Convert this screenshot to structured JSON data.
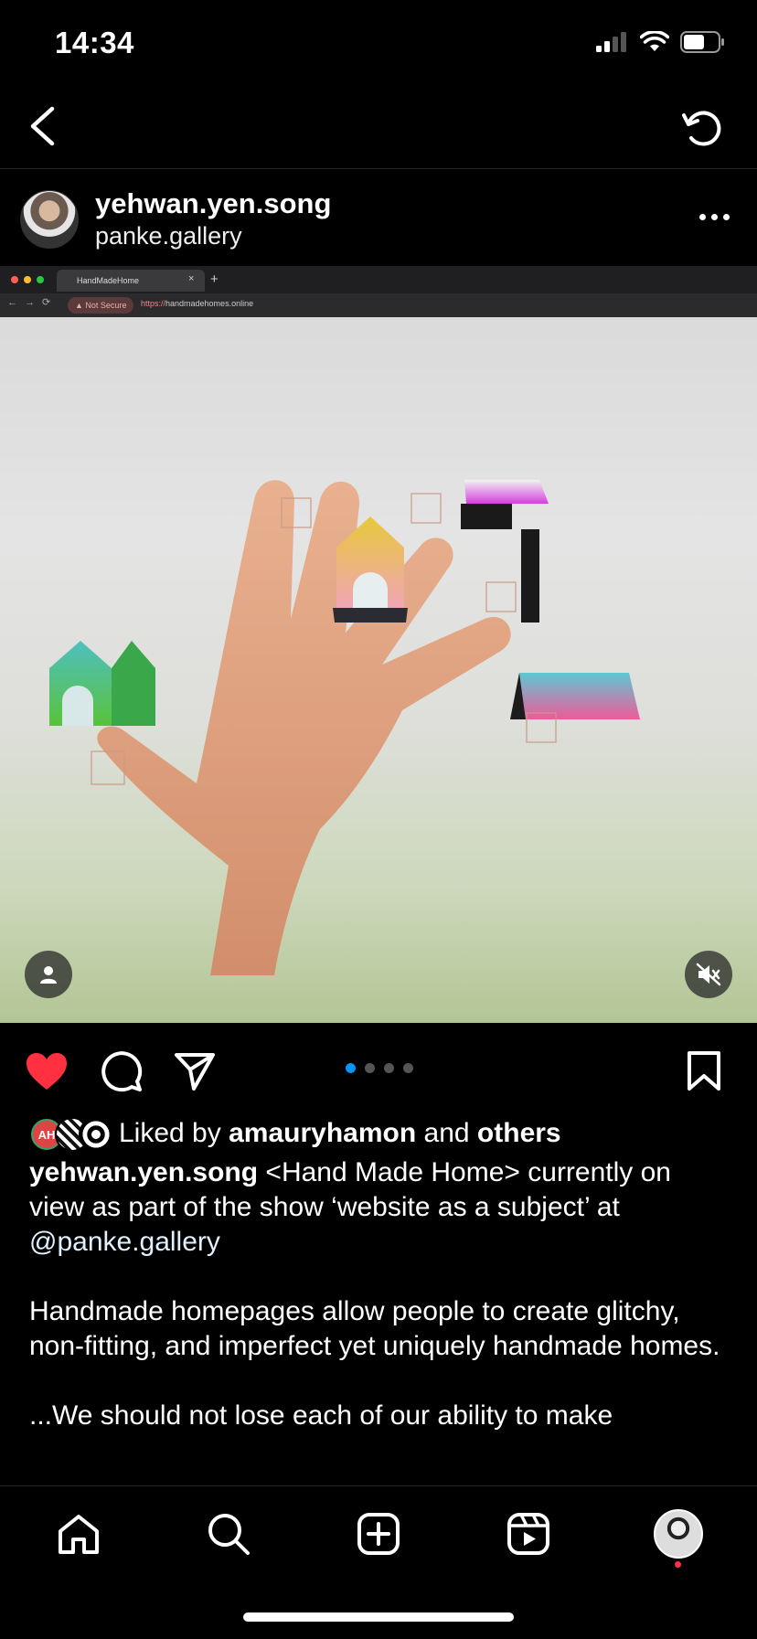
{
  "status_bar": {
    "time": "14:34"
  },
  "post": {
    "username": "yehwan.yen.song",
    "location": "panke.gallery"
  },
  "browser": {
    "tab_title": "HandMadeHome",
    "not_secure": "Not Secure",
    "url_scheme": "https://",
    "url_host": "handmadehomes.online"
  },
  "carousel": {
    "count": 4,
    "active_index": 0
  },
  "likes": {
    "prefix": "Liked by",
    "user": "amauryhamon",
    "joiner": "and",
    "others": "others",
    "avatar_initials": "AH"
  },
  "caption": {
    "username": "yehwan.yen.song",
    "line1": "<Hand Made Home> currently on view as part of the show ‘website as a subject’ at",
    "mention": "@panke.gallery",
    "para2": "Handmade homepages allow people to create glitchy, non-fitting, and imperfect yet uniquely handmade homes.",
    "para3": "...We should not lose each of our ability to make"
  },
  "colors": {
    "like_red": "#ff3040",
    "carousel_active": "#0095f6",
    "background": "#000000"
  },
  "icons": {
    "back": "chevron-left-icon",
    "refresh": "refresh-icon",
    "more": "more-horizontal-icon",
    "like": "heart-icon",
    "comment": "comment-icon",
    "share": "paper-plane-icon",
    "save": "bookmark-icon",
    "home": "home-icon",
    "search": "search-icon",
    "create": "plus-square-icon",
    "reels": "reels-icon"
  }
}
